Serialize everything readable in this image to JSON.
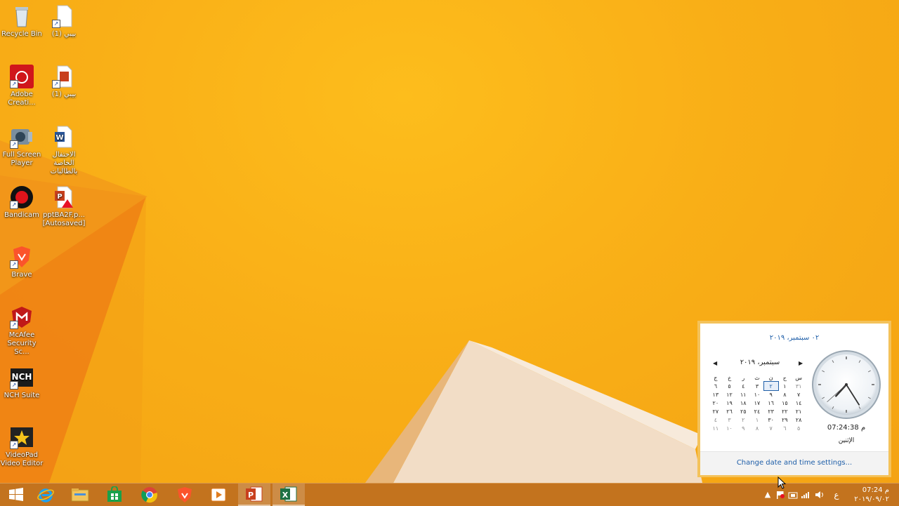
{
  "desktop": {
    "icons": [
      {
        "label": "Recycle Bin"
      },
      {
        "label": "بيبي (1)"
      },
      {
        "label": "Adobe Creati..."
      },
      {
        "label": "بيبي (1)"
      },
      {
        "label": "Full Screen Player"
      },
      {
        "label": "الاحتفال الخاصة بالطالبات"
      },
      {
        "label": "Bandicam"
      },
      {
        "label": "pptBA2F.p... [Autosaved]"
      },
      {
        "label": "Brave"
      },
      {
        "label": "McAfee Security Sc..."
      },
      {
        "label": "NCH Suite"
      },
      {
        "label": "VideoPad Video Editor"
      }
    ]
  },
  "taskbar": {
    "buttons": [
      "start",
      "internet-explorer",
      "file-explorer",
      "store",
      "chrome",
      "brave",
      "media-player",
      "powerpoint",
      "excel"
    ],
    "tray": {
      "input_indicator": "ع",
      "time": "07:24 م",
      "date": "٢٠١٩/٠٩/٠٢"
    }
  },
  "calendar_flyout": {
    "long_date": "٠٢ سبتمبر، ٢٠١٩",
    "month_title": "سبتمبر، ٢٠١٩",
    "weekdays": [
      "ج",
      "خ",
      "ر",
      "ث",
      "ن",
      "ح",
      "س"
    ],
    "weeks": [
      [
        "٦",
        "٥",
        "٤",
        "٣",
        "٢",
        "١",
        "٣١"
      ],
      [
        "١٣",
        "١٢",
        "١١",
        "١٠",
        "٩",
        "٨",
        "٧"
      ],
      [
        "٢٠",
        "١٩",
        "١٨",
        "١٧",
        "١٦",
        "١٥",
        "١٤"
      ],
      [
        "٢٧",
        "٢٦",
        "٢٥",
        "٢٤",
        "٢٣",
        "٢٢",
        "٢١"
      ],
      [
        "٤",
        "٣",
        "٢",
        "١",
        "٣٠",
        "٢٩",
        "٢٨"
      ],
      [
        "١١",
        "١٠",
        "٩",
        "٨",
        "٧",
        "٦",
        "٥"
      ]
    ],
    "digital_time": "07:24:38 م",
    "day_name": "الإثنين",
    "change_settings_link": "Change date and time settings...",
    "clock": {
      "hour": 7,
      "minute": 24,
      "second": 38
    }
  },
  "colors": {
    "accent": "#1e5ea8",
    "taskbar": "#be6e1e",
    "wallpaper": "#f9af17"
  }
}
